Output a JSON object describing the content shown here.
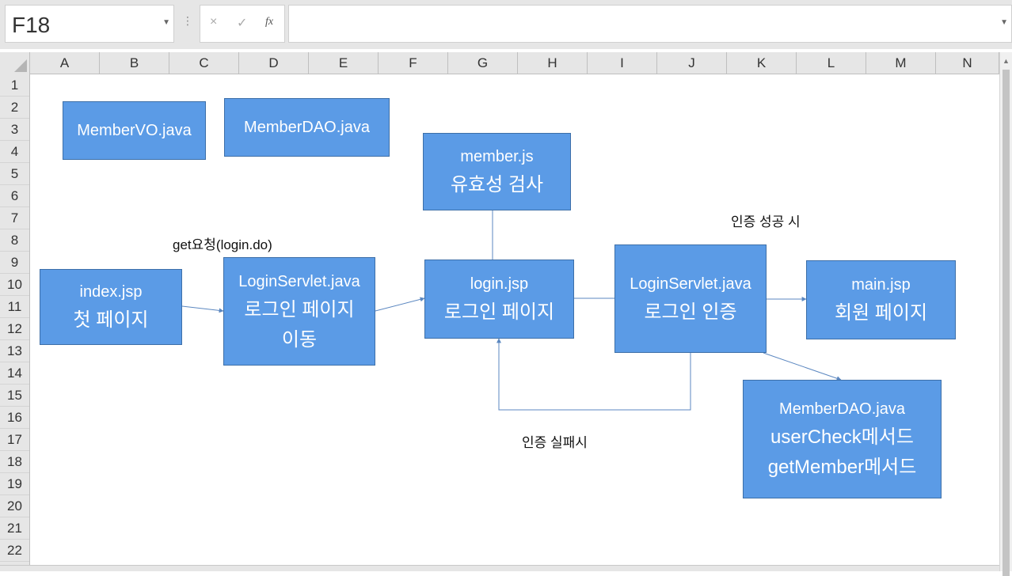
{
  "formula_bar": {
    "name_box": "F18",
    "cancel_symbol": "×",
    "enter_symbol": "✓",
    "fx_symbol": "fx",
    "more_symbol": "⋮",
    "formula": ""
  },
  "columns": [
    "A",
    "B",
    "C",
    "D",
    "E",
    "F",
    "G",
    "H",
    "I",
    "J",
    "K",
    "L",
    "M",
    "N"
  ],
  "rows": [
    "1",
    "2",
    "3",
    "4",
    "5",
    "6",
    "7",
    "8",
    "9",
    "10",
    "11",
    "12",
    "13",
    "14",
    "15",
    "16",
    "17",
    "18",
    "19",
    "20",
    "21",
    "22"
  ],
  "shapes": {
    "membervo": [
      "MemberVO.java"
    ],
    "memberdao_top": [
      "MemberDAO.java"
    ],
    "member_js": [
      "member.js",
      "유효성 검사"
    ],
    "index_jsp": [
      "index.jsp",
      "첫 페이지"
    ],
    "login_servlet_move": [
      "LoginServlet.java",
      "로그인 페이지",
      "이동"
    ],
    "login_jsp": [
      "login.jsp",
      "로그인 페이지"
    ],
    "login_servlet_auth": [
      "LoginServlet.java",
      "로그인 인증"
    ],
    "main_jsp": [
      "main.jsp",
      "회원 페이지"
    ],
    "memberdao_methods": [
      "MemberDAO.java",
      "userCheck메서드",
      "getMember메서드"
    ]
  },
  "labels": {
    "get_request": "get요청(login.do)",
    "auth_success": "인증 성공 시",
    "auth_fail": "인증 실패시"
  },
  "colors": {
    "shape_fill": "#5b9be6",
    "shape_border": "#3d6fa8",
    "connector": "#5b87c0"
  }
}
